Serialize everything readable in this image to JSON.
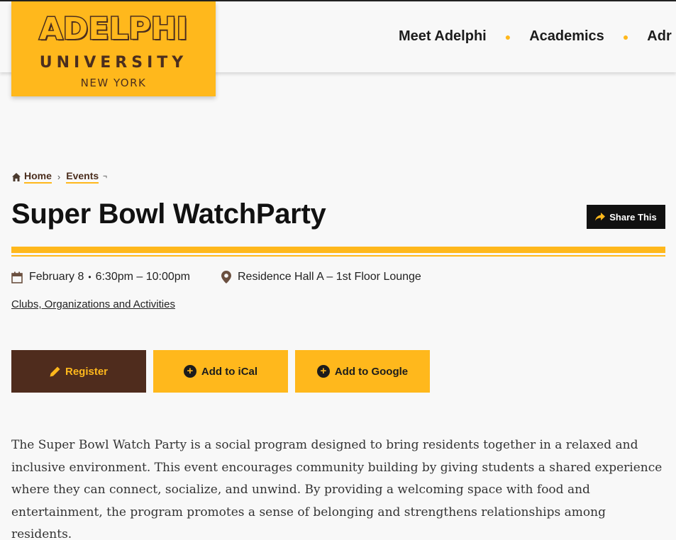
{
  "logo": {
    "name": "ADELPHI",
    "university": "UNIVERSITY",
    "location": "NEW YORK"
  },
  "nav": {
    "items": [
      "Meet Adelphi",
      "Academics",
      "Adr"
    ]
  },
  "breadcrumb": {
    "home": "Home",
    "events": "Events",
    "separator": "›"
  },
  "event": {
    "title": "Super Bowl WatchParty",
    "share_label": "Share This",
    "date": "February 8",
    "time": "6:30pm – 10:00pm",
    "location": "Residence Hall A – 1st Floor Lounge",
    "category": "Clubs, Organizations and Activities"
  },
  "actions": {
    "register": "Register",
    "ical": "Add to iCal",
    "google": "Add to Google"
  },
  "description": "The Super Bowl Watch Party is a social program designed to bring residents together in a relaxed and inclusive environment. This event encourages community building by giving students a shared experience where they can connect, socialize, and unwind. By providing a welcoming space with food and entertainment, the program promotes a sense of belonging and strengthens relationships among residents.",
  "colors": {
    "brand_gold": "#ffb81c",
    "brand_brown": "#4f2c1d",
    "text_dark": "#1c1c1c"
  },
  "icons": [
    "home-icon",
    "share-arrow-icon",
    "calendar-icon",
    "location-pin-icon",
    "pencil-icon",
    "plus-circle-icon"
  ]
}
